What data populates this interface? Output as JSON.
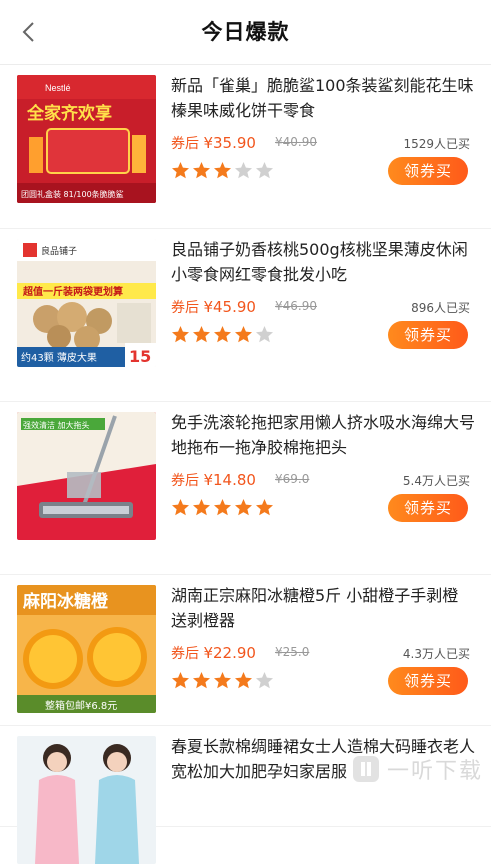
{
  "header": {
    "title": "今日爆款"
  },
  "products": [
    {
      "name": "新品「雀巢」脆脆鲨100条装鲨刻能花生味榛果味威化饼干零食",
      "price_prefix": "券后",
      "price": "¥35.90",
      "original_price": "¥40.90",
      "sold": "1529人已买",
      "rating": 3,
      "button": "领券买",
      "image_text": "全家齐欢享",
      "image_sub": "团圆礼盒装 81/100条脆脆鲨",
      "image_brand": "Nestlé"
    },
    {
      "name": "良品铺子奶香核桃500g核桃坚果薄皮休闲小零食网红零食批发小吃",
      "price_prefix": "券后",
      "price": "¥45.90",
      "original_price": "¥46.90",
      "sold": "896人已买",
      "rating": 4,
      "button": "领券买",
      "image_text": "超值一斤装两袋更划算",
      "image_sub": "约43颗 薄皮大果",
      "image_brand": "良品铺子",
      "image_badge": "15"
    },
    {
      "name": "免手洗滚轮拖把家用懒人挤水吸水海绵大号地拖布一拖净胶棉拖把头",
      "price_prefix": "券后",
      "price": "¥14.80",
      "original_price": "¥69.0",
      "sold": "5.4万人已买",
      "rating": 5,
      "button": "领券买",
      "image_text": "强效清洁 加大拖头"
    },
    {
      "name": "湖南正宗麻阳冰糖橙5斤 小甜橙子手剥橙 送剥橙器",
      "price_prefix": "券后",
      "price": "¥22.90",
      "original_price": "¥25.0",
      "sold": "4.3万人已买",
      "rating": 4,
      "button": "领券买",
      "image_text": "麻阳冰糖橙",
      "image_sub": "整箱包邮¥6.8元"
    },
    {
      "name": "春夏长款棉绸睡裙女士人造棉大码睡衣老人宽松加大加肥孕妇家居服"
    }
  ],
  "watermark": "一听下载",
  "colors": {
    "accent": "#f2561d",
    "button": "#ff6a1a",
    "star_on": "#f47a1c",
    "star_off": "#d0d0d0"
  }
}
